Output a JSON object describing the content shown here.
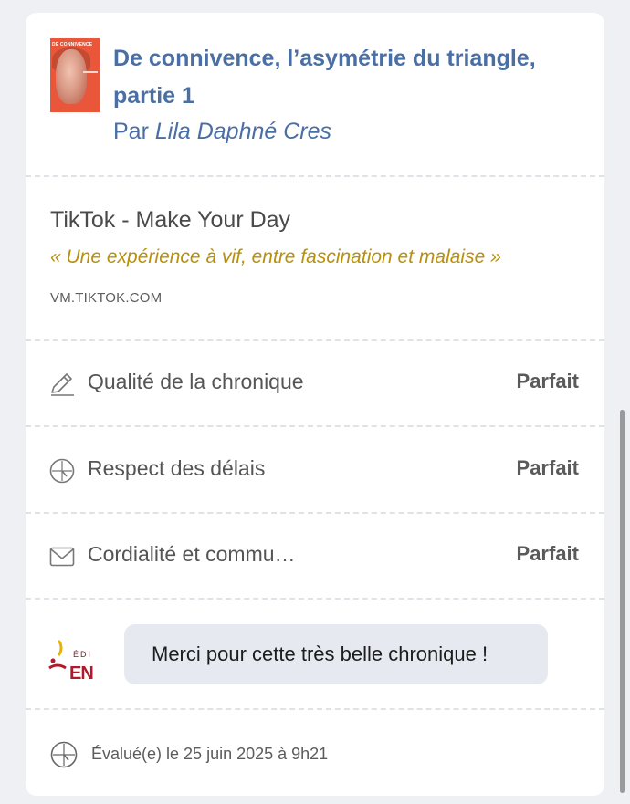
{
  "book": {
    "cover_title": "DE CONNIVENCE",
    "title": "De connivence, l’asymétrie du triangle, partie 1",
    "author_prefix": "Par ",
    "author_name": "Lila Daphné Cres"
  },
  "link": {
    "title": "TikTok - Make Your Day",
    "quote": "« Une expérience à vif, entre fascination et malaise »",
    "domain": "VM.TIKTOK.COM"
  },
  "ratings": [
    {
      "icon": "pencil-icon",
      "label": "Qualité de la chronique",
      "value": "Parfait"
    },
    {
      "icon": "clock-icon",
      "label": "Respect des délais",
      "value": "Parfait"
    },
    {
      "icon": "envelope-icon",
      "label": "Cordialité et commu…",
      "value": "Parfait"
    }
  ],
  "reply": {
    "logo_small": "ÉDI",
    "logo_big": "EN",
    "message": "Merci pour cette très belle chronique !"
  },
  "footer": {
    "icon": "clock-icon",
    "text": "Évalué(e) le 25 juin 2025 à 9h21"
  },
  "colors": {
    "accent_blue": "#4a6fa5",
    "quote_gold": "#b8900c",
    "cover_orange": "#e9563a",
    "logo_red": "#b11a2b"
  }
}
